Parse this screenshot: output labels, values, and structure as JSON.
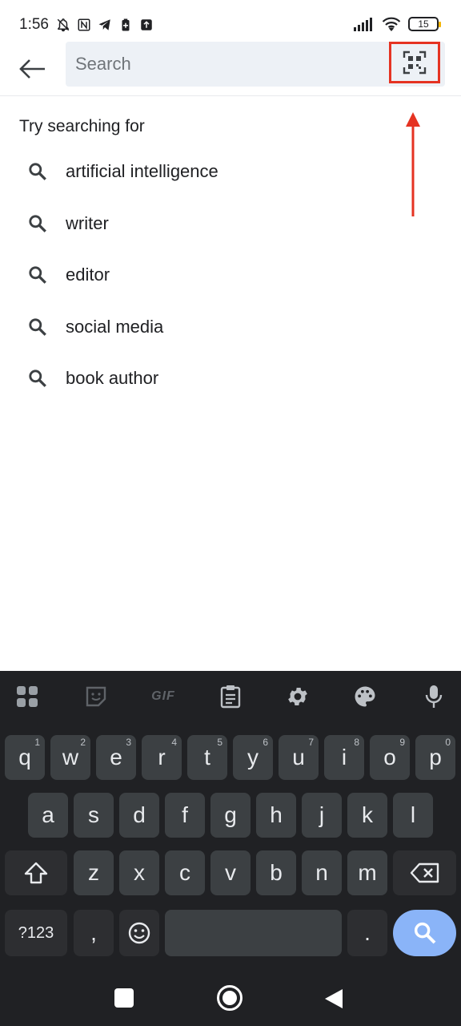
{
  "status_bar": {
    "time": "1:56",
    "battery": "15"
  },
  "search": {
    "placeholder": "Search"
  },
  "suggestions": {
    "title": "Try searching for",
    "items": [
      "artificial intelligence",
      "writer",
      "editor",
      "social media",
      "book author"
    ]
  },
  "keyboard": {
    "toolbar": {
      "gif_label": "GIF"
    },
    "row1": [
      {
        "label": "q",
        "hint": "1"
      },
      {
        "label": "w",
        "hint": "2"
      },
      {
        "label": "e",
        "hint": "3"
      },
      {
        "label": "r",
        "hint": "4"
      },
      {
        "label": "t",
        "hint": "5"
      },
      {
        "label": "y",
        "hint": "6"
      },
      {
        "label": "u",
        "hint": "7"
      },
      {
        "label": "i",
        "hint": "8"
      },
      {
        "label": "o",
        "hint": "9"
      },
      {
        "label": "p",
        "hint": "0"
      }
    ],
    "row2": [
      "a",
      "s",
      "d",
      "f",
      "g",
      "h",
      "j",
      "k",
      "l"
    ],
    "row3": [
      "z",
      "x",
      "c",
      "v",
      "b",
      "n",
      "m"
    ],
    "row4": {
      "symbols_label": "?123",
      "comma_label": ",",
      "period_label": "."
    }
  },
  "colors": {
    "annotation": "#e53322",
    "search_box_bg": "#edf1f6",
    "keyboard_bg": "#202124",
    "search_key": "#8ab4f8"
  }
}
